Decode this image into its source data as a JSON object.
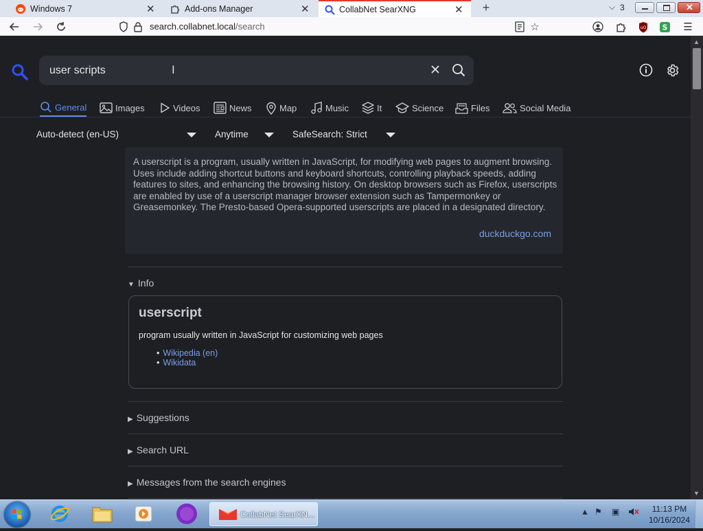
{
  "browser": {
    "tabs": [
      {
        "title": "Windows 7",
        "active": false
      },
      {
        "title": "Add-ons Manager",
        "active": false
      },
      {
        "title": "CollabNet SearXNG",
        "active": true
      }
    ],
    "tab_count": "3",
    "url_host": "search.collabnet.local",
    "url_path": "/search"
  },
  "search": {
    "query": "user scripts"
  },
  "categories": [
    {
      "label": "General",
      "icon": "search-icon",
      "selected": true
    },
    {
      "label": "Images",
      "icon": "image-icon",
      "selected": false
    },
    {
      "label": "Videos",
      "icon": "play-icon",
      "selected": false
    },
    {
      "label": "News",
      "icon": "newspaper-icon",
      "selected": false
    },
    {
      "label": "Map",
      "icon": "map-pin-icon",
      "selected": false
    },
    {
      "label": "Music",
      "icon": "music-note-icon",
      "selected": false
    },
    {
      "label": "It",
      "icon": "layers-icon",
      "selected": false
    },
    {
      "label": "Science",
      "icon": "science-icon",
      "selected": false
    },
    {
      "label": "Files",
      "icon": "files-icon",
      "selected": false
    },
    {
      "label": "Social Media",
      "icon": "people-icon",
      "selected": false
    }
  ],
  "filters": {
    "language": "Auto-detect (en-US)",
    "time": "Anytime",
    "safesearch": "SafeSearch: Strict"
  },
  "answer": {
    "text": "A userscript is a program, usually written in JavaScript, for modifying web pages to augment browsing. Uses include adding shortcut buttons and keyboard shortcuts, controlling playback speeds, adding features to sites, and enhancing the browsing history. On desktop browsers such as Firefox, userscripts are enabled by use of a userscript manager browser extension such as Tampermonkey or Greasemonkey. The Presto-based Opera-supported userscripts are placed in a designated directory.",
    "source": "duckduckgo.com"
  },
  "infobox": {
    "section_label": "Info",
    "title": "userscript",
    "description": "program usually written in JavaScript for customizing web pages",
    "links": [
      "Wikipedia (en)",
      "Wikidata"
    ]
  },
  "sections": {
    "suggestions": "Suggestions",
    "search_url": "Search URL",
    "messages": "Messages from the search engines"
  },
  "taskbar": {
    "active_task": "CollabNet SearXN...",
    "time": "11:13 PM",
    "date": "10/16/2024"
  }
}
